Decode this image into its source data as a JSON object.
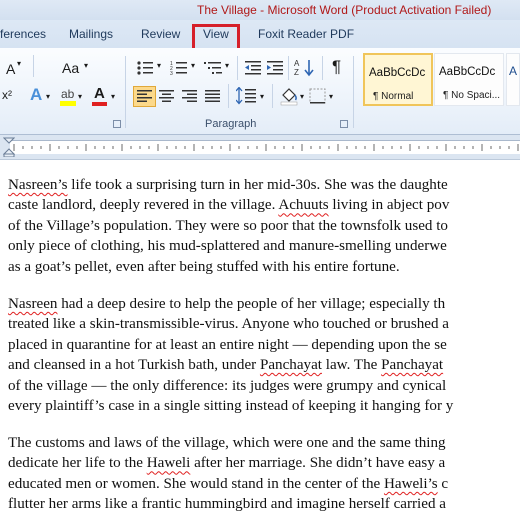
{
  "window": {
    "title": "The Village  -  Microsoft Word (Product Activation Failed)"
  },
  "tabs": [
    {
      "label": "ferences"
    },
    {
      "label": "Mailings"
    },
    {
      "label": "Review"
    },
    {
      "label": "View"
    },
    {
      "label": "Foxit Reader PDF"
    }
  ],
  "ribbon": {
    "font_a": "A",
    "change_case": "Aa",
    "group_paragraph": "Paragraph",
    "show_marks": "¶",
    "styles": [
      {
        "preview": "AaBbCcDc",
        "name": "¶ Normal"
      },
      {
        "preview": "AaBbCcDc",
        "name": "¶ No Spaci..."
      }
    ],
    "highlight_color": "#ffff00",
    "font_color": "#e02020"
  },
  "document": {
    "paragraphs": [
      [
        [
          {
            "t": "Nasreen’s",
            "sq": true
          },
          {
            "t": " life took a surprising turn in her mid-30s. She was the daughte"
          }
        ],
        [
          {
            "t": "caste landlord, deeply revered in the village. "
          },
          {
            "t": "Achuuts",
            "sq": true
          },
          {
            "t": " living in abject pov"
          }
        ],
        [
          {
            "t": "of the Village’s population. They were so poor that the townsfolk used to"
          }
        ],
        [
          {
            "t": "only piece of clothing, his mud-splattered and manure-smelling underwe"
          }
        ],
        [
          {
            "t": "as a goat’s pellet, even after being stuffed with his entire fortune."
          }
        ]
      ],
      [
        [
          {
            "t": "Nasreen",
            "sq": true
          },
          {
            "t": " had a deep desire to help the people of her village; especially th"
          }
        ],
        [
          {
            "t": "treated like a skin-transmissible-virus. Anyone who touched or brushed a"
          }
        ],
        [
          {
            "t": "placed in quarantine for at least an entire night — depending upon the se"
          }
        ],
        [
          {
            "t": "and cleansed in a hot Turkish bath, under "
          },
          {
            "t": "Panchayat",
            "sq": true
          },
          {
            "t": " law. The "
          },
          {
            "t": "Panchayat",
            "sq": true
          }
        ],
        [
          {
            "t": "of the village — the only difference: its judges were grumpy and cynical"
          }
        ],
        [
          {
            "t": "every plaintiff’s case in a single sitting instead of keeping it hanging for y"
          }
        ]
      ],
      [
        [
          {
            "t": "The customs and laws of the village, which were one and the same thing"
          }
        ],
        [
          {
            "t": "dedicate her life to the "
          },
          {
            "t": "Haweli",
            "sq": true
          },
          {
            "t": " after her marriage. She didn’t have easy a"
          }
        ],
        [
          {
            "t": "educated men or women. She would stand in the center of the "
          },
          {
            "t": "Haweli’s",
            "sq": true
          },
          {
            "t": " c"
          }
        ],
        [
          {
            "t": "flutter her arms like a frantic hummingbird and imagine herself carried a"
          }
        ]
      ]
    ]
  }
}
